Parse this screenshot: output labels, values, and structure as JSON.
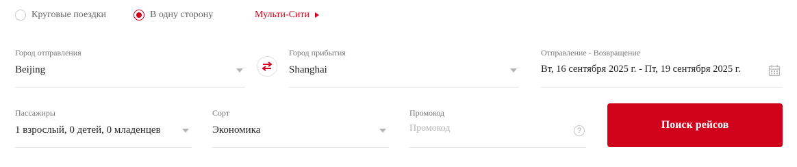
{
  "trip_type": {
    "round_trip": "Круговые поездки",
    "one_way": "В одну сторону",
    "multi_city": "Мульти-Сити",
    "selected": "one_way"
  },
  "from": {
    "label": "Город отправления",
    "value": "Beijing"
  },
  "to": {
    "label": "Город прибытия",
    "value": "Shanghai"
  },
  "dates": {
    "label": "Отправление - Возвращение",
    "value": "Вт, 16 сентября 2025 г. - Пт, 19 сентября 2025 г."
  },
  "passengers": {
    "label": "Пассажиры",
    "value": "1 взрослый, 0 детей, 0 младенцев"
  },
  "cabin": {
    "label": "Сорт",
    "value": "Экономика"
  },
  "promo": {
    "label": "Промокод",
    "placeholder": "Промокод",
    "help_glyph": "?"
  },
  "search_button": "Поиск рейсов",
  "colors": {
    "accent": "#d0021b"
  },
  "icons": [
    "radio-icon",
    "triangle-right-icon",
    "swap-icon",
    "calendar-icon",
    "chevron-down-icon",
    "question-icon"
  ]
}
